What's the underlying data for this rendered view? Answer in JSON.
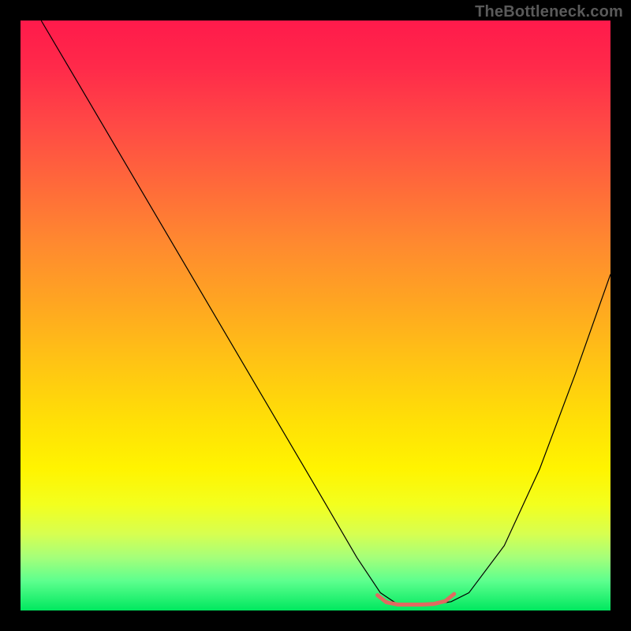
{
  "watermark": "TheBottleneck.com",
  "chart_data": {
    "type": "line",
    "title": "",
    "xlabel": "",
    "ylabel": "",
    "xlim": [
      0,
      100
    ],
    "ylim": [
      0,
      100
    ],
    "grid": false,
    "series": [
      {
        "name": "curve",
        "stroke": "#000000",
        "stroke_width": 1.2,
        "x": [
          3.5,
          10,
          20,
          30,
          40,
          50,
          57,
          61,
          64,
          67,
          70,
          73,
          76,
          82,
          88,
          94,
          100
        ],
        "values": [
          100,
          89,
          72,
          55,
          38,
          21,
          9,
          3,
          1,
          1,
          1,
          1.5,
          3,
          11,
          24,
          40,
          57
        ]
      },
      {
        "name": "bottleneck-marker",
        "stroke": "#e06a60",
        "stroke_width": 5,
        "x": [
          60.5,
          62,
          64,
          66,
          68,
          70,
          72,
          73.5
        ],
        "values": [
          2.6,
          1.4,
          1,
          1,
          1,
          1.1,
          1.6,
          2.8
        ]
      }
    ]
  }
}
